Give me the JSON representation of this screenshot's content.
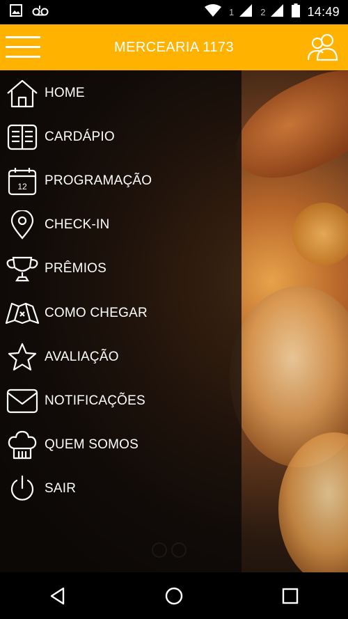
{
  "status_bar": {
    "time": "14:49",
    "sim1": "1",
    "sim2": "2",
    "icons": [
      "image-icon",
      "voicemail-icon",
      "wifi-icon",
      "signal-icon",
      "battery-icon"
    ]
  },
  "app_bar": {
    "title": "MERCEARIA 1173",
    "color": "#ffb200",
    "left_icon": "hamburger-menu-icon",
    "right_icon": "users-icon"
  },
  "drawer": {
    "items": [
      {
        "label": "HOME",
        "icon": "home-icon"
      },
      {
        "label": "CARDÁPIO",
        "icon": "menu-book-icon"
      },
      {
        "label": "PROGRAMAÇÃO",
        "icon": "calendar-icon",
        "icon_text": "12"
      },
      {
        "label": "CHECK-IN",
        "icon": "location-pin-icon"
      },
      {
        "label": "PRÊMIOS",
        "icon": "trophy-icon"
      },
      {
        "label": "COMO CHEGAR",
        "icon": "map-icon"
      },
      {
        "label": "AVALIAÇÃO",
        "icon": "star-icon"
      },
      {
        "label": "NOTIFICAÇÕES",
        "icon": "envelope-icon"
      },
      {
        "label": "QUEM SOMOS",
        "icon": "chef-hat-icon"
      },
      {
        "label": "SAIR",
        "icon": "power-icon"
      }
    ]
  },
  "nav_bar": {
    "icons": [
      "back-icon",
      "home-circle-icon",
      "recents-icon"
    ]
  }
}
